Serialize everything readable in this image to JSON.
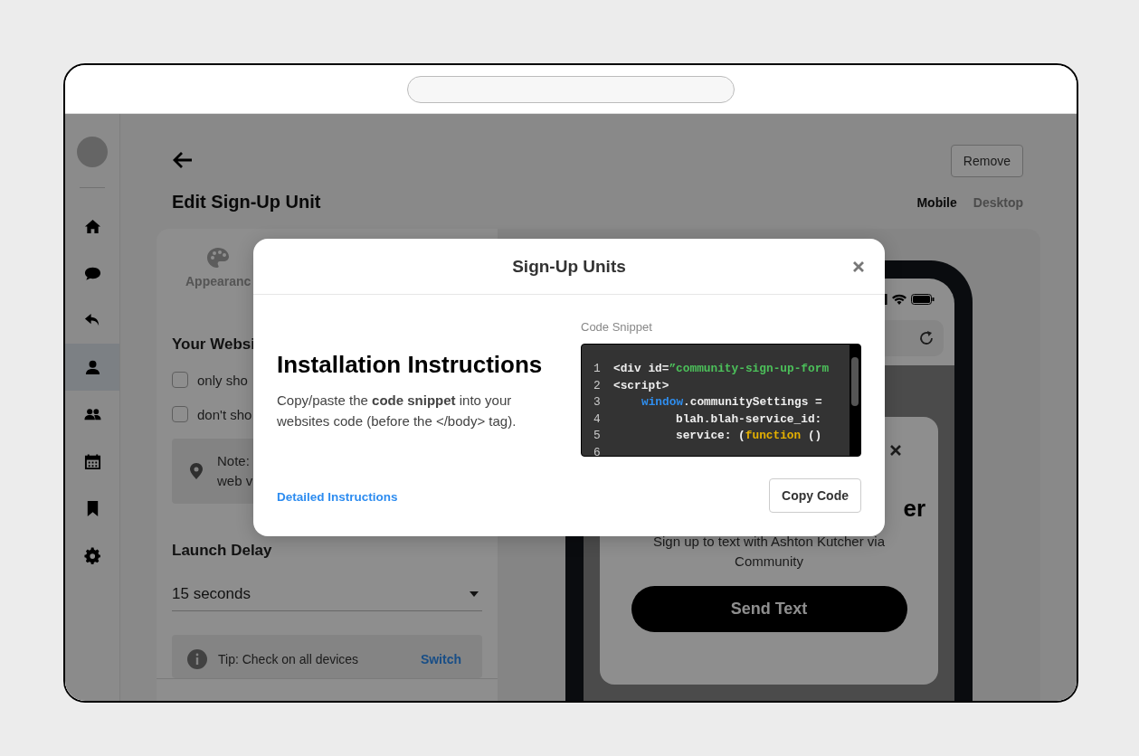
{
  "sidebar": {
    "items": [
      {
        "kind": "home",
        "selected": false
      },
      {
        "kind": "chat",
        "selected": false
      },
      {
        "kind": "reply",
        "selected": false
      },
      {
        "kind": "person",
        "selected": true
      },
      {
        "kind": "people",
        "selected": false
      },
      {
        "kind": "calendar",
        "selected": false
      },
      {
        "kind": "bookmark",
        "selected": false
      },
      {
        "kind": "settings",
        "selected": false
      }
    ]
  },
  "page": {
    "title": "Edit Sign-Up Unit",
    "remove_button": "Remove",
    "view_tabs": [
      {
        "label": "Mobile",
        "selected": true
      },
      {
        "label": "Desktop",
        "selected": false
      }
    ]
  },
  "settings_panel": {
    "tab_label": "Appearanc",
    "website_heading": "Your Websi",
    "options": [
      {
        "label": "only sho",
        "checked": false
      },
      {
        "label": "don't sho",
        "checked": false
      }
    ],
    "note": [
      "Note:",
      "web v"
    ],
    "launch_delay_heading": "Launch Delay",
    "launch_delay_value": "15 seconds",
    "tip": "Tip: Check on all devices",
    "tip_link": "Switch"
  },
  "preview": {
    "heading": "er",
    "subtitle": "Sign up to text with Ashton Kutcher via Community",
    "button": "Send Text"
  },
  "modal": {
    "title": "Sign-Up Units",
    "heading": "Installation Instructions",
    "description": "Copy/paste the **code snippet** into your websites code (before the </body> tag).",
    "snippet_label": "Code Snippet",
    "code_lines": [
      {
        "number": "1",
        "tokens": [
          {
            "kind": "plain",
            "text": "<div id="
          },
          {
            "kind": "string",
            "text": "”community-sign-up-form"
          }
        ]
      },
      {
        "number": "2",
        "tokens": [
          {
            "kind": "plain",
            "text": "<script>"
          }
        ]
      },
      {
        "number": "3",
        "kind": "block",
        "tokens": [
          {
            "kind": "keyword",
            "text": "window"
          },
          {
            "kind": "plain",
            "text": ".communitySettings ="
          }
        ]
      },
      {
        "number": "4",
        "kind": "inner",
        "tokens": [
          {
            "kind": "plain",
            "text": "blah.blah-service_id:"
          }
        ]
      },
      {
        "number": "5",
        "kind": "inner",
        "tokens": [
          {
            "kind": "plain",
            "text": "service: ("
          },
          {
            "kind": "function",
            "text": "function"
          },
          {
            "kind": "plain",
            "text": " ()"
          }
        ]
      },
      {
        "number": "6"
      }
    ],
    "link": "Detailed Instructions",
    "copy_button": "Copy Code"
  }
}
